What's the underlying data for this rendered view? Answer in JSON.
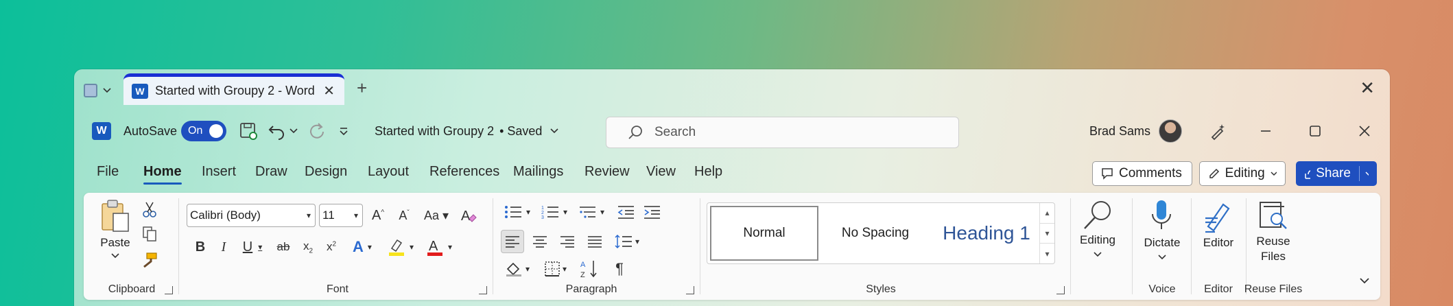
{
  "tab": {
    "title": "Started with Groupy 2 - Word",
    "close": "✕",
    "new": "+"
  },
  "window": {
    "close": "✕"
  },
  "titlebar": {
    "autosave_label": "AutoSave",
    "autosave_state": "On",
    "doc_title": "Started with Groupy 2",
    "doc_status": "• Saved",
    "search_placeholder": "Search",
    "user_name": "Brad Sams"
  },
  "menu": [
    "File",
    "Home",
    "Insert",
    "Draw",
    "Design",
    "Layout",
    "References",
    "Mailings",
    "Review",
    "View",
    "Help"
  ],
  "actions": {
    "comments": "Comments",
    "editing": "Editing",
    "share": "Share"
  },
  "ribbon": {
    "clipboard": {
      "paste": "Paste",
      "label": "Clipboard"
    },
    "font": {
      "name": "Calibri (Body)",
      "size": "11",
      "label": "Font"
    },
    "paragraph": {
      "label": "Paragraph"
    },
    "styles": {
      "items": [
        "Normal",
        "No Spacing",
        "Heading 1"
      ],
      "label": "Styles"
    },
    "editing": {
      "label": "Editing"
    },
    "voice": {
      "dictate": "Dictate",
      "label": "Voice"
    },
    "editor": {
      "button": "Editor",
      "label": "Editor"
    },
    "reuse": {
      "button_line1": "Reuse",
      "button_line2": "Files",
      "label": "Reuse Files"
    }
  },
  "colors": {
    "word_blue": "#185abd",
    "accent": "#1f4fbf",
    "tab_indicator": "#1a2fd4"
  }
}
